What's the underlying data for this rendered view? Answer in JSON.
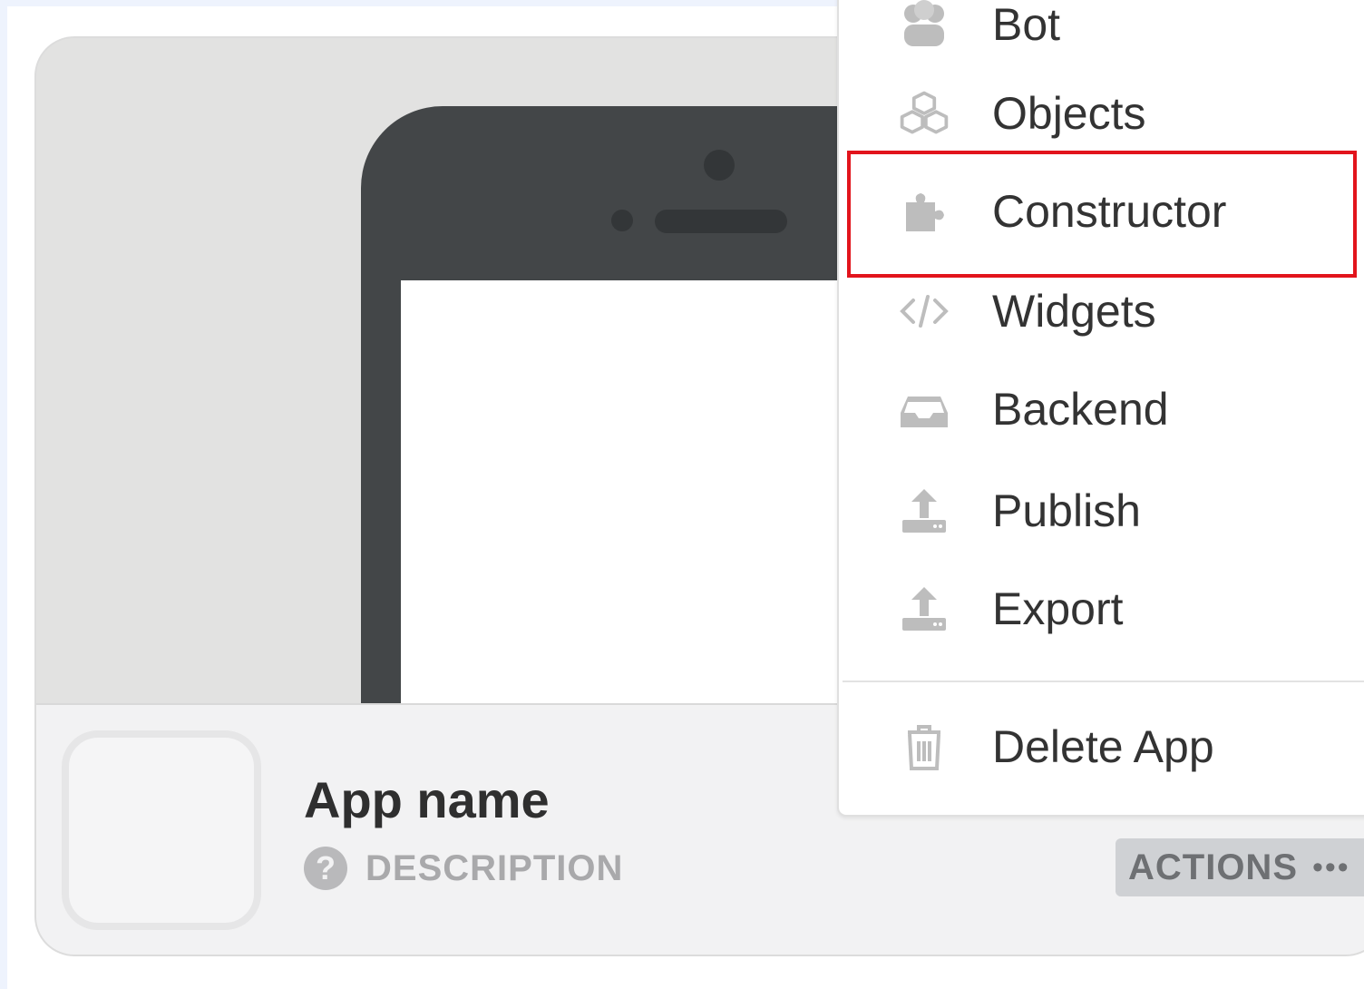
{
  "app_card": {
    "name": "App name",
    "description_label": "DESCRIPTION",
    "help_glyph": "?",
    "actions_label": "ACTIONS",
    "actions_dots": "•••"
  },
  "menu": {
    "items": [
      {
        "label": "Bot",
        "icon": "bot-icon"
      },
      {
        "label": "Objects",
        "icon": "cubes-icon"
      },
      {
        "label": "Constructor",
        "icon": "puzzle-icon",
        "highlighted": true
      },
      {
        "label": "Widgets",
        "icon": "code-icon"
      },
      {
        "label": "Backend",
        "icon": "inbox-icon"
      },
      {
        "label": "Publish",
        "icon": "upload-icon"
      },
      {
        "label": "Export",
        "icon": "upload-icon"
      },
      {
        "label": "Delete App",
        "icon": "trash-icon"
      }
    ]
  },
  "colors": {
    "highlight": "#e2141c",
    "icon_gray": "#bdbdbd",
    "phone": "#434648"
  }
}
